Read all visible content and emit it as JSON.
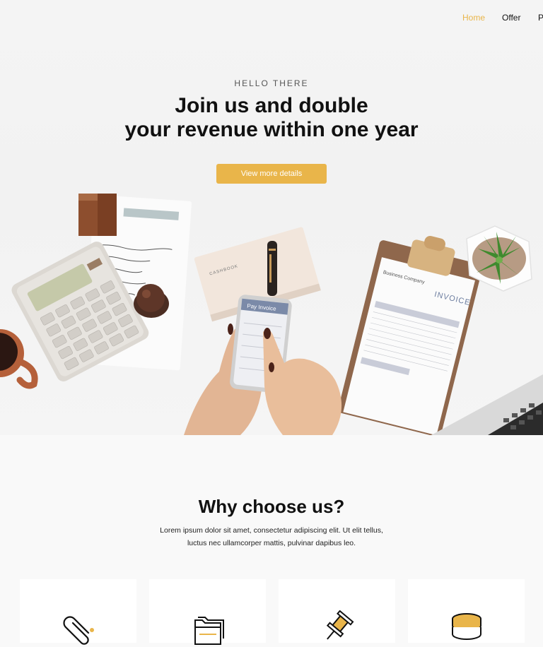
{
  "nav": {
    "items": [
      {
        "label": "Home",
        "active": true
      },
      {
        "label": "Offer",
        "active": false
      },
      {
        "label": "P",
        "active": false
      }
    ]
  },
  "hero": {
    "eyebrow": "HELLO THERE",
    "headline_line1": "Join us and double",
    "headline_line2": "your revenue within one year",
    "cta_label": "View more details",
    "photo_texts": {
      "app_title": "Pay Invoice",
      "notebook": "CASHBOOK",
      "invoice_word": "INVOICE",
      "invoice_company": "Business Company"
    }
  },
  "why": {
    "title": "Why choose us?",
    "text_line1": "Lorem ipsum dolor sit amet, consectetur adipiscing elit. Ut elit tellus,",
    "text_line2": "luctus nec ullamcorper mattis, pulvinar dapibus leo.",
    "cards": [
      {
        "icon": "paperclip-icon"
      },
      {
        "icon": "folders-icon"
      },
      {
        "icon": "pin-icon"
      },
      {
        "icon": "coins-icon"
      }
    ]
  },
  "colors": {
    "accent": "#e9b54a",
    "text": "#111111",
    "background": "#f9f9f9"
  }
}
